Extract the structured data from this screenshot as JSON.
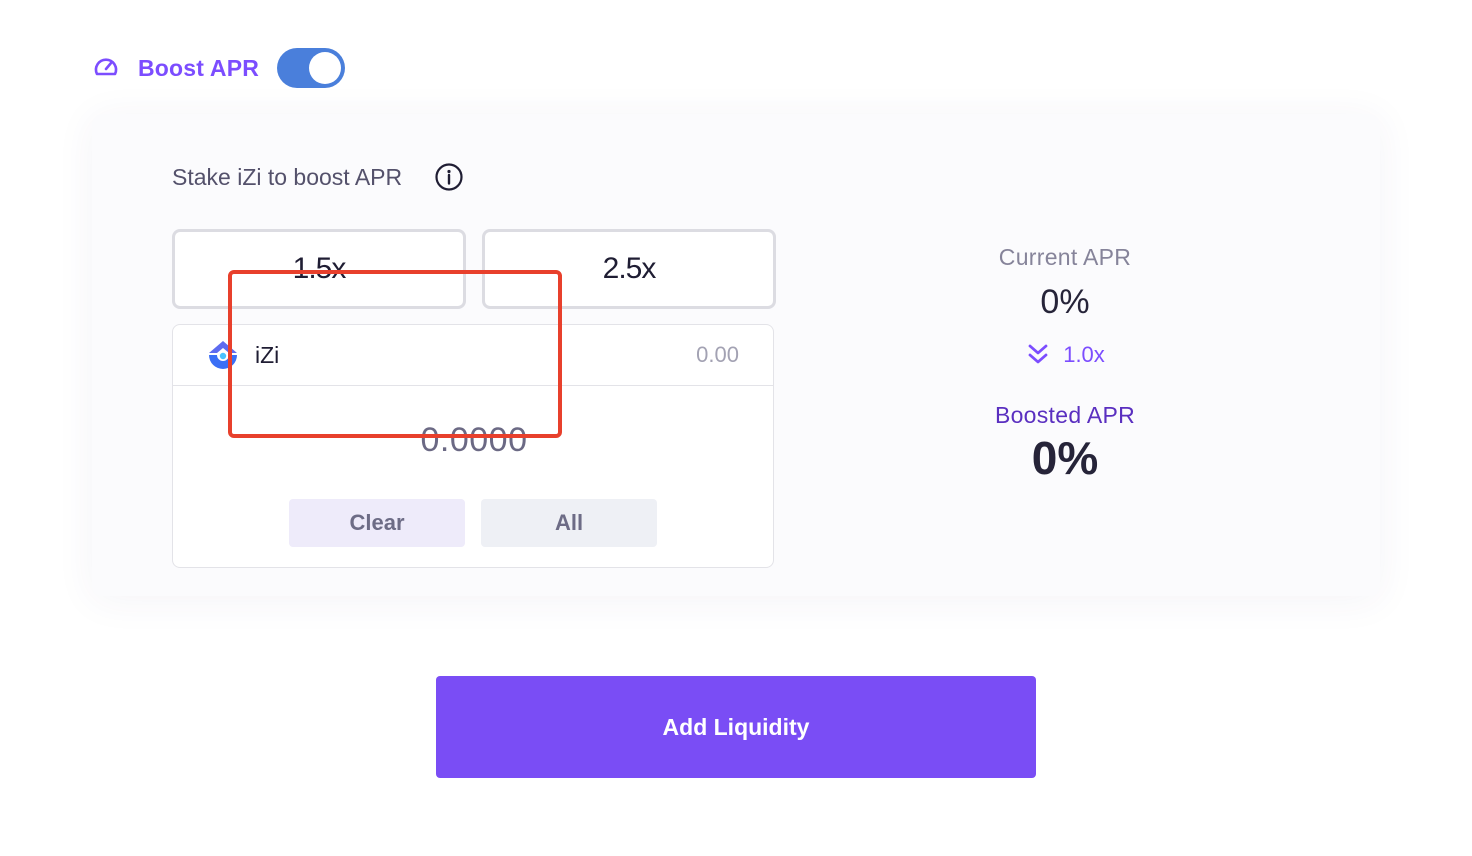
{
  "boost": {
    "title": "Boost APR",
    "toggle_on": true
  },
  "stake": {
    "label": "Stake iZi to boost APR",
    "multipliers": [
      "1.5x",
      "2.5x"
    ]
  },
  "token": {
    "name": "iZi",
    "balance": "0.00",
    "amount": "0.0000",
    "clear_label": "Clear",
    "all_label": "All"
  },
  "apr": {
    "current_label": "Current APR",
    "current_value": "0%",
    "multiplier": "1.0x",
    "boosted_label": "Boosted APR",
    "boosted_value": "0%"
  },
  "actions": {
    "add_liquidity_label": "Add Liquidity"
  },
  "colors": {
    "accent": "#7c4dff",
    "toggle": "#4a7fdb",
    "highlight": "#e8402c",
    "primary_button": "#7a4df5"
  }
}
